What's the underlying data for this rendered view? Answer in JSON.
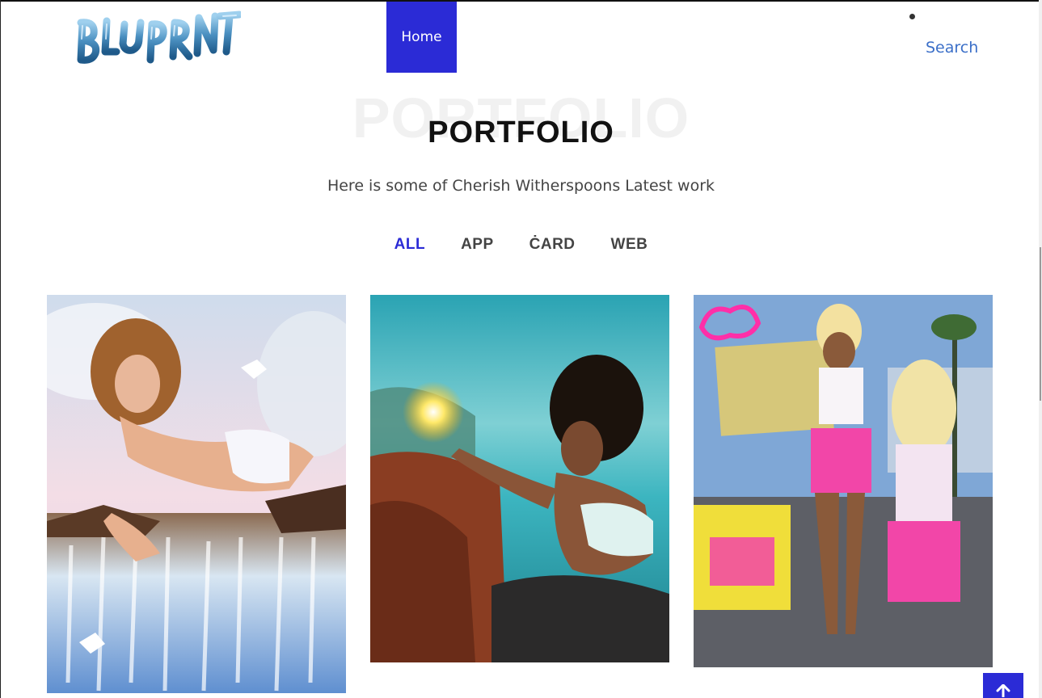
{
  "header": {
    "logo_text": "BLUPRNT",
    "nav": {
      "home_label": "Home",
      "search_label": "Search"
    }
  },
  "section": {
    "ghost_title": "PORTFOLIO",
    "title": "PORTFOLIO",
    "subtitle": "Here is some of Cherish Witherspoons Latest work"
  },
  "filters": [
    {
      "label": "ALL",
      "active": true
    },
    {
      "label": "APP",
      "active": false
    },
    {
      "label": "ĊARD",
      "active": false
    },
    {
      "label": "WEB",
      "active": false
    }
  ],
  "portfolio": {
    "items": [
      {
        "icon": "portfolio-image-waterfall"
      },
      {
        "icon": "portfolio-image-ocean-light"
      },
      {
        "icon": "portfolio-image-collage"
      }
    ]
  },
  "colors": {
    "accent": "#2b2bd6",
    "link": "#3b6fc8",
    "title": "#111111"
  },
  "back_to_top_icon": "arrow-up-icon"
}
